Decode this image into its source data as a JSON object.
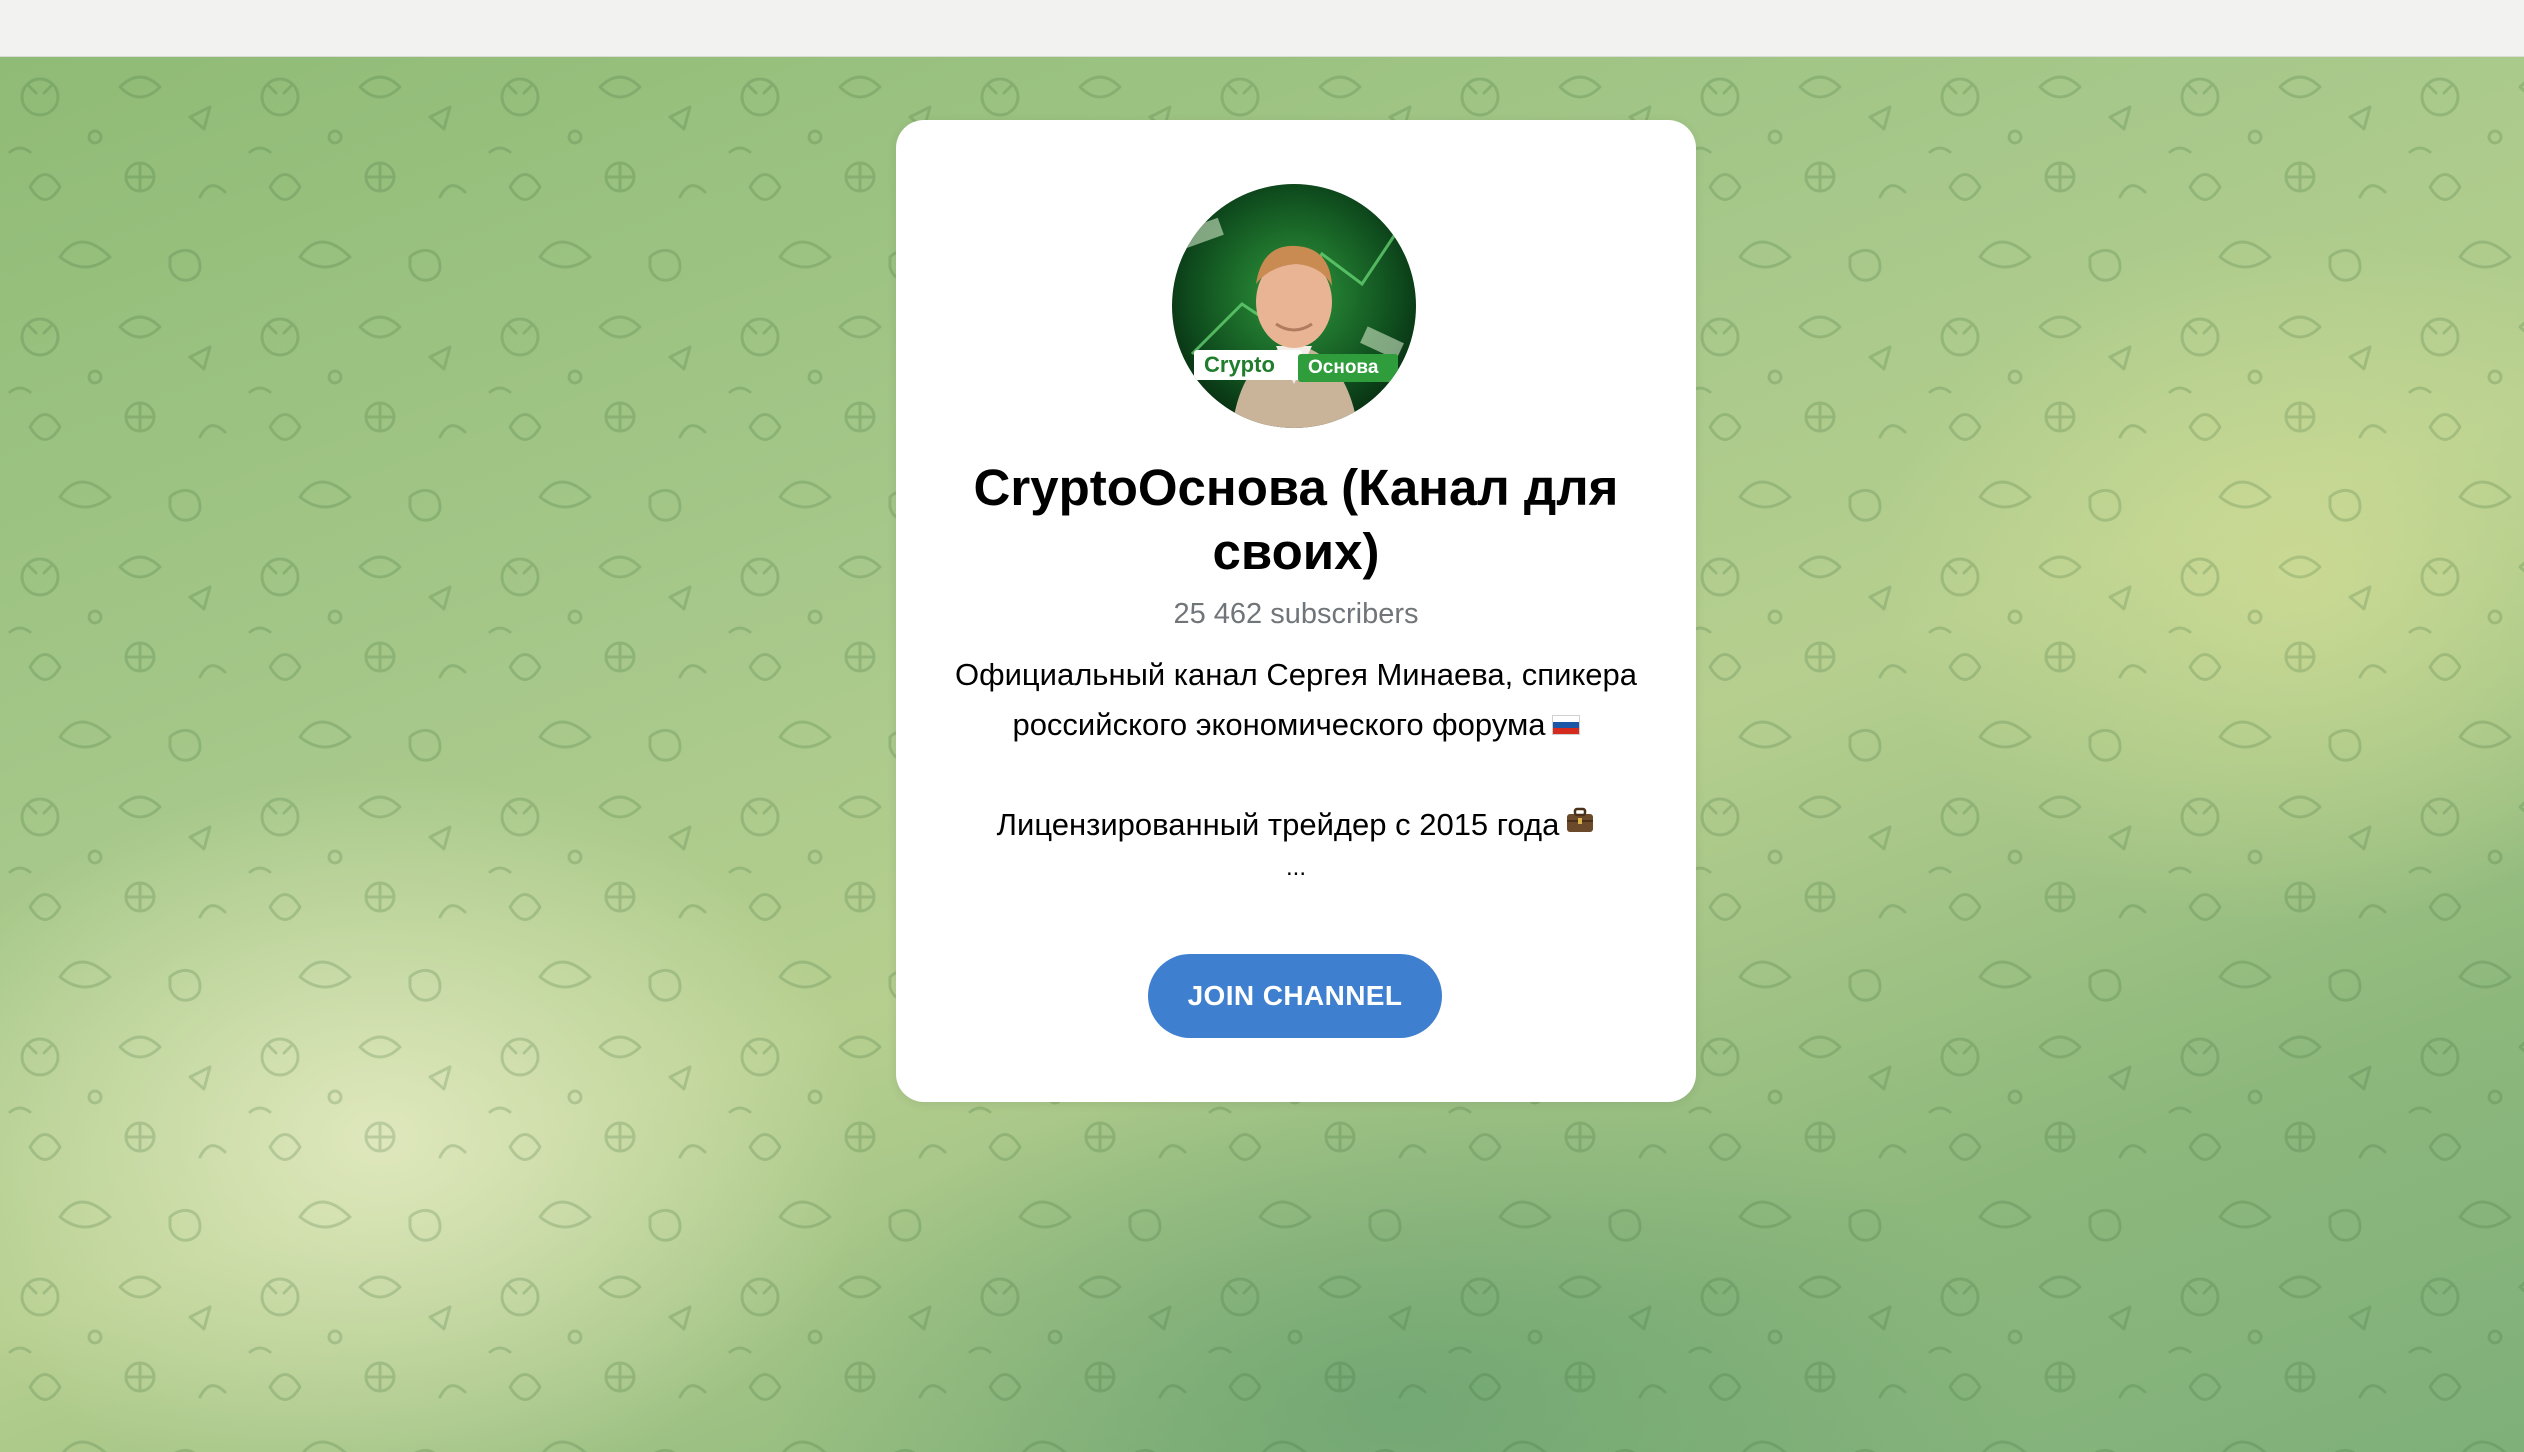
{
  "colors": {
    "accent": "#3f7fd0",
    "background": "#a6c88a",
    "card": "#ffffff",
    "subtitle": "#707579"
  },
  "channel": {
    "title": "CryptoОснова (Канал для своих)",
    "subscribers": "25 462 subscribers",
    "description_line1": "Официальный канал Сергея Минаева, спикера",
    "description_line2": "российского экономического форума",
    "description_line2_icon": "russia-flag-icon",
    "description_line3": "Лицензированный трейдер с 2015 года",
    "description_line3_icon": "briefcase-icon",
    "description_more": "...",
    "avatar_label_left": "Crypto",
    "avatar_label_right": "Основа"
  },
  "actions": {
    "join_label": "JOIN CHANNEL"
  }
}
